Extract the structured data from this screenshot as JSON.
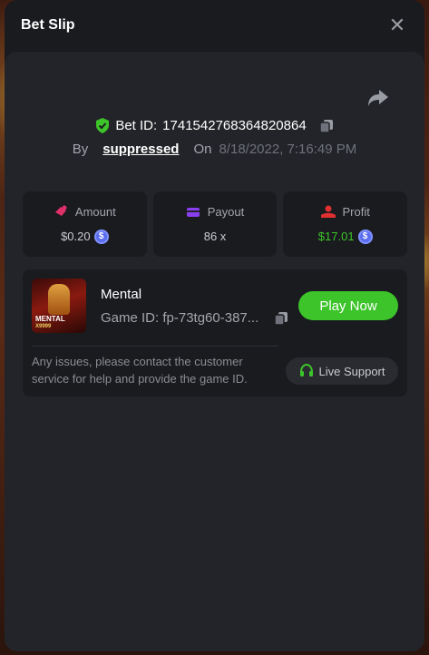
{
  "header": {
    "title": "Bet Slip"
  },
  "bet": {
    "id_label": "Bet ID:",
    "id_value": "1741542768364820864",
    "by_label": "By",
    "user": "suppressed",
    "on_label": "On",
    "date": "8/18/2022, 7:16:49 PM"
  },
  "stats": {
    "amount": {
      "label": "Amount",
      "value": "$0.20"
    },
    "payout": {
      "label": "Payout",
      "value": "86 x"
    },
    "profit": {
      "label": "Profit",
      "value": "$17.01"
    }
  },
  "game": {
    "name": "Mental",
    "id_text": "Game ID: fp-73tg60-387...",
    "thumb_title": "MENTAL",
    "thumb_sub": "X9999",
    "play_label": "Play Now"
  },
  "support": {
    "text": "Any issues, please contact the customer service for help and provide the game ID.",
    "button_label": "Live Support"
  },
  "colors": {
    "accent": "#3cc42a",
    "coin": "#5a6cf0",
    "amount_icon": "#e0306a",
    "payout_icon": "#8a3ef0",
    "profit_icon": "#e03030"
  },
  "icons": [
    "close-icon",
    "share-icon",
    "shield-check-icon",
    "copy-icon",
    "amount-icon",
    "payout-icon",
    "profit-icon",
    "coin-icon",
    "headset-icon"
  ]
}
